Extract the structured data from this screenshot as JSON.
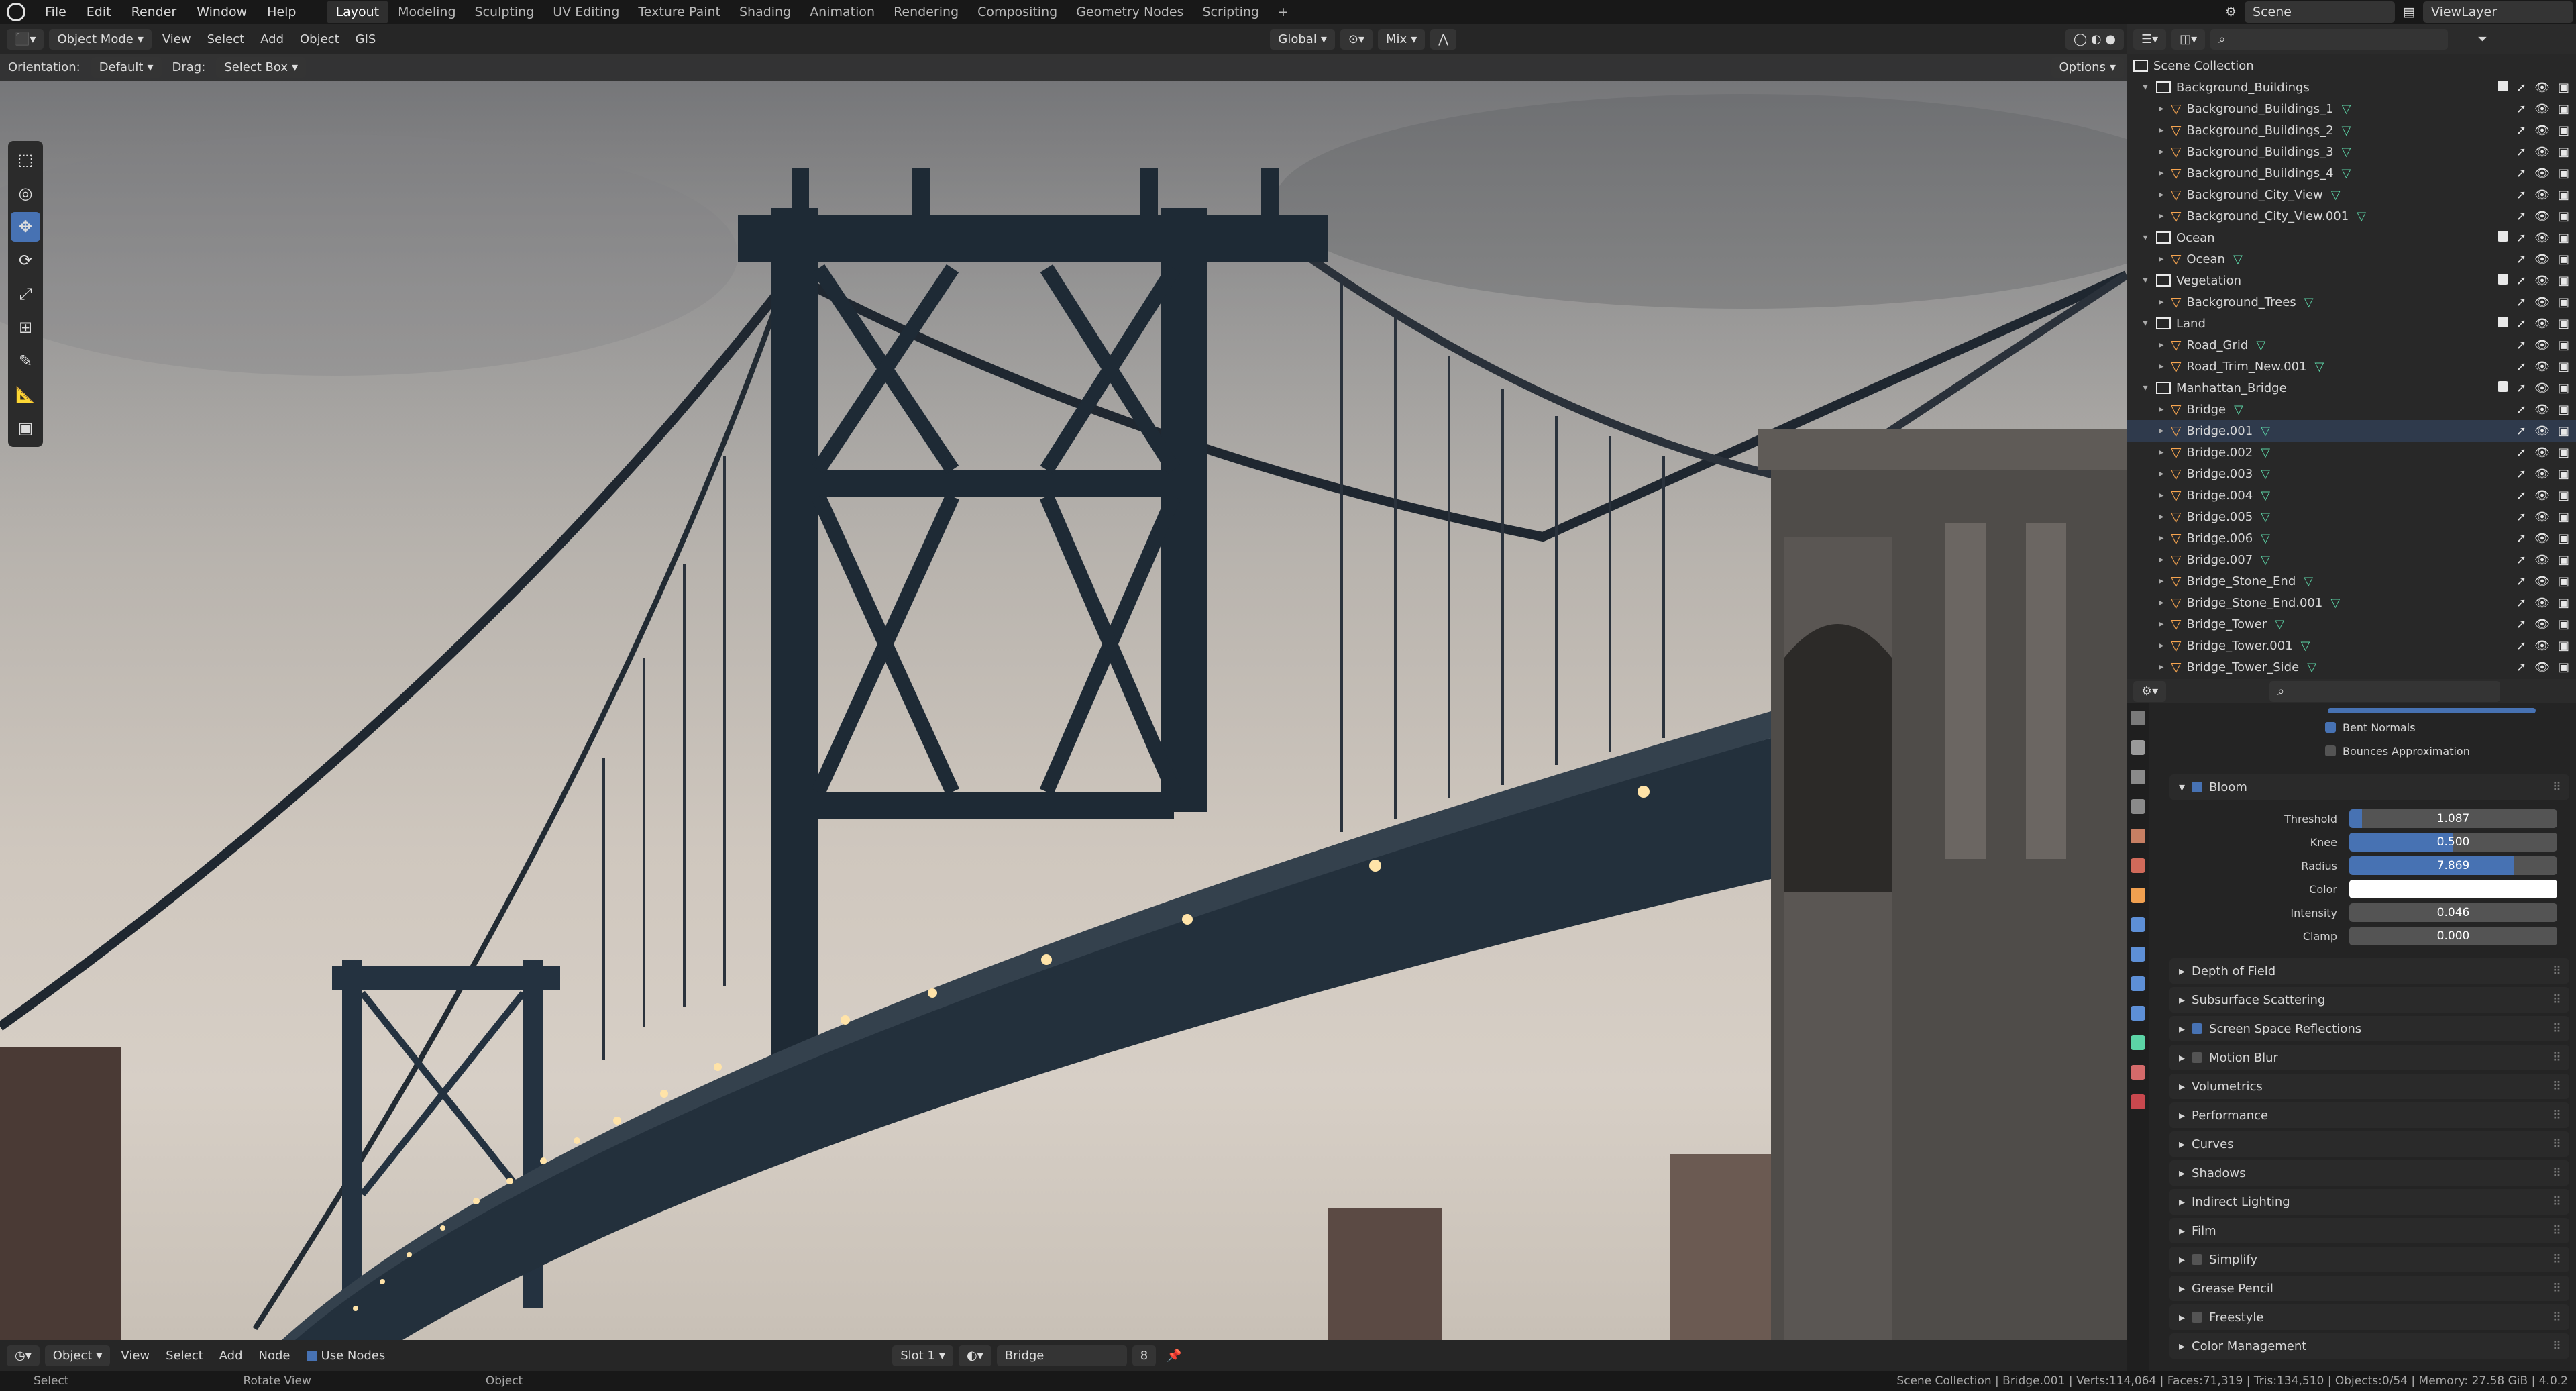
{
  "app": {
    "menus": [
      "File",
      "Edit",
      "Render",
      "Window",
      "Help"
    ],
    "workspaces": [
      "Layout",
      "Modeling",
      "Sculpting",
      "UV Editing",
      "Texture Paint",
      "Shading",
      "Animation",
      "Rendering",
      "Compositing",
      "Geometry Nodes",
      "Scripting"
    ],
    "active_workspace": "Layout",
    "scene": "Scene",
    "view_layer": "ViewLayer"
  },
  "viewport_header": {
    "mode": "Object Mode",
    "menus": [
      "View",
      "Select",
      "Add",
      "Object",
      "GIS"
    ],
    "transform": "Global",
    "blend": "Mix",
    "orientation_label": "Orientation:",
    "orientation": "Default",
    "drag_label": "Drag:",
    "drag": "Select Box",
    "options": "Options"
  },
  "outliner": {
    "root": "Scene Collection",
    "rows": [
      {
        "name": "Background_Buildings",
        "type": "collection",
        "depth": 0
      },
      {
        "name": "Background_Buildings_1",
        "type": "object",
        "depth": 1
      },
      {
        "name": "Background_Buildings_2",
        "type": "object",
        "depth": 1
      },
      {
        "name": "Background_Buildings_3",
        "type": "object",
        "depth": 1
      },
      {
        "name": "Background_Buildings_4",
        "type": "object",
        "depth": 1
      },
      {
        "name": "Background_City_View",
        "type": "object",
        "depth": 1
      },
      {
        "name": "Background_City_View.001",
        "type": "object",
        "depth": 1
      },
      {
        "name": "Ocean",
        "type": "collection",
        "depth": 0
      },
      {
        "name": "Ocean",
        "type": "object",
        "depth": 1
      },
      {
        "name": "Vegetation",
        "type": "collection",
        "depth": 0
      },
      {
        "name": "Background_Trees",
        "type": "object",
        "depth": 1
      },
      {
        "name": "Land",
        "type": "collection",
        "depth": 0
      },
      {
        "name": "Road_Grid",
        "type": "object",
        "depth": 1
      },
      {
        "name": "Road_Trim_New.001",
        "type": "object",
        "depth": 1
      },
      {
        "name": "Manhattan_Bridge",
        "type": "collection",
        "depth": 0
      },
      {
        "name": "Bridge",
        "type": "object",
        "depth": 1
      },
      {
        "name": "Bridge.001",
        "type": "object",
        "depth": 1
      },
      {
        "name": "Bridge.002",
        "type": "object",
        "depth": 1
      },
      {
        "name": "Bridge.003",
        "type": "object",
        "depth": 1
      },
      {
        "name": "Bridge.004",
        "type": "object",
        "depth": 1
      },
      {
        "name": "Bridge.005",
        "type": "object",
        "depth": 1
      },
      {
        "name": "Bridge.006",
        "type": "object",
        "depth": 1
      },
      {
        "name": "Bridge.007",
        "type": "object",
        "depth": 1
      },
      {
        "name": "Bridge_Stone_End",
        "type": "object",
        "depth": 1
      },
      {
        "name": "Bridge_Stone_End.001",
        "type": "object",
        "depth": 1
      },
      {
        "name": "Bridge_Tower",
        "type": "object",
        "depth": 1
      },
      {
        "name": "Bridge_Tower.001",
        "type": "object",
        "depth": 1
      },
      {
        "name": "Bridge_Tower_Side",
        "type": "object",
        "depth": 1
      }
    ]
  },
  "properties": {
    "checkboxes": [
      {
        "label": "Bent Normals",
        "checked": true
      },
      {
        "label": "Bounces Approximation",
        "checked": false
      }
    ],
    "bloom": {
      "label": "Bloom",
      "fields": [
        {
          "label": "Threshold",
          "value": "1.087",
          "fill": 0.06
        },
        {
          "label": "Knee",
          "value": "0.500",
          "fill": 0.5
        },
        {
          "label": "Radius",
          "value": "7.869",
          "fill": 0.79
        },
        {
          "label": "Color",
          "value": "",
          "fill": 0
        },
        {
          "label": "Intensity",
          "value": "0.046",
          "fill": 0
        },
        {
          "label": "Clamp",
          "value": "0.000",
          "fill": 0
        }
      ]
    },
    "panels": [
      {
        "label": "Depth of Field",
        "checkbox": null
      },
      {
        "label": "Subsurface Scattering",
        "checkbox": null
      },
      {
        "label": "Screen Space Reflections",
        "checkbox": true
      },
      {
        "label": "Motion Blur",
        "checkbox": false
      },
      {
        "label": "Volumetrics",
        "checkbox": null
      },
      {
        "label": "Performance",
        "checkbox": null
      },
      {
        "label": "Curves",
        "checkbox": null
      },
      {
        "label": "Shadows",
        "checkbox": null
      },
      {
        "label": "Indirect Lighting",
        "checkbox": null
      },
      {
        "label": "Film",
        "checkbox": null
      },
      {
        "label": "Simplify",
        "checkbox": false
      },
      {
        "label": "Grease Pencil",
        "checkbox": null
      },
      {
        "label": "Freestyle",
        "checkbox": false
      },
      {
        "label": "Color Management",
        "checkbox": null
      }
    ]
  },
  "node_bar": {
    "editor": "Object",
    "menus": [
      "View",
      "Select",
      "Add",
      "Node"
    ],
    "use_nodes": "Use Nodes",
    "slot": "Slot 1",
    "material": "Bridge",
    "users": "8"
  },
  "status_bar": {
    "left": [
      "Select",
      "Rotate View",
      "Object"
    ],
    "stats": "Scene Collection | Bridge.001 | Verts:114,064 | Faces:71,319 | Tris:134,510 | Objects:0/54 | Memory: 27.58 GiB | 4.0.2"
  },
  "colors": {
    "accent": "#4772b3",
    "object": "#f6a44f",
    "mesh": "#5cd4a6",
    "panel": "#2a2a2a"
  }
}
